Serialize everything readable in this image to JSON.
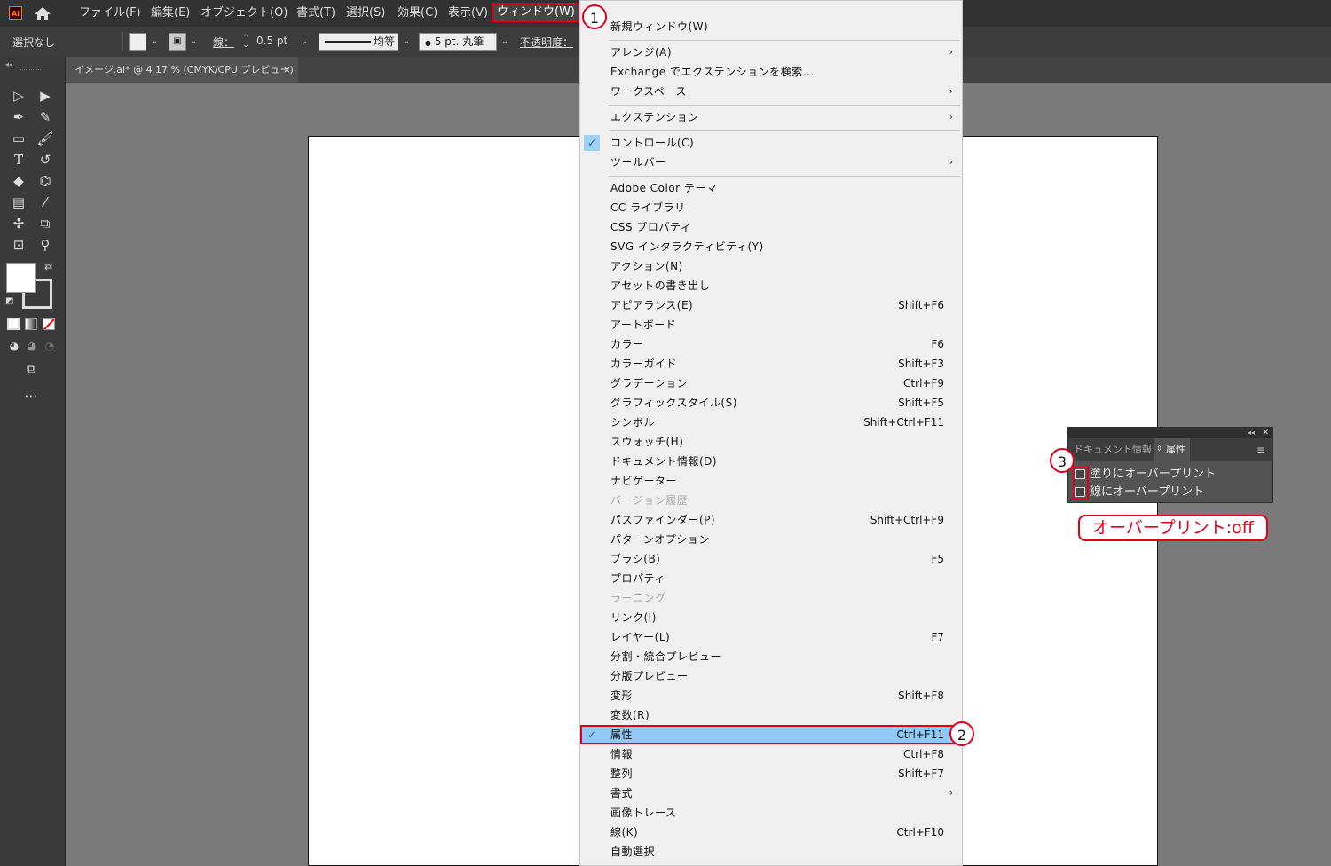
{
  "app": {
    "logo": "Ai"
  },
  "menubar": {
    "items": [
      "ファイル(F)",
      "編集(E)",
      "オブジェクト(O)",
      "書式(T)",
      "選択(S)",
      "効果(C)",
      "表示(V)"
    ],
    "active": "ウィンドウ(W)"
  },
  "control_bar": {
    "selection": "選択なし",
    "stroke_label": "線：",
    "stroke_weight": "0.5 pt",
    "stroke_profile": "均等",
    "brush": "5 pt. 丸筆",
    "opacity_label": "不透明度："
  },
  "document_tab": {
    "title": "イメージ.ai* @ 4.17 % (CMYK/CPU プレビュー)",
    "close": "×"
  },
  "dropdown": {
    "items": [
      {
        "label": "新規ウィンドウ(W)"
      },
      {
        "label": "アレンジ(A)",
        "submenu": true
      },
      {
        "label": "Exchange でエクステンションを検索..."
      },
      {
        "label": "ワークスペース",
        "submenu": true
      },
      {
        "label": "エクステンション",
        "submenu": true
      },
      {
        "label": "コントロール(C)",
        "checked": true
      },
      {
        "label": "ツールバー",
        "submenu": true
      },
      {
        "label": "Adobe Color テーマ"
      },
      {
        "label": "CC ライブラリ"
      },
      {
        "label": "CSS プロパティ"
      },
      {
        "label": "SVG インタラクティビティ(Y)"
      },
      {
        "label": "アクション(N)"
      },
      {
        "label": "アセットの書き出し"
      },
      {
        "label": "アピアランス(E)",
        "shortcut": "Shift+F6"
      },
      {
        "label": "アートボード"
      },
      {
        "label": "カラー",
        "shortcut": "F6"
      },
      {
        "label": "カラーガイド",
        "shortcut": "Shift+F3"
      },
      {
        "label": "グラデーション",
        "shortcut": "Ctrl+F9"
      },
      {
        "label": "グラフィックスタイル(S)",
        "shortcut": "Shift+F5"
      },
      {
        "label": "シンボル",
        "shortcut": "Shift+Ctrl+F11"
      },
      {
        "label": "スウォッチ(H)"
      },
      {
        "label": "ドキュメント情報(D)"
      },
      {
        "label": "ナビゲーター"
      },
      {
        "label": "バージョン履歴",
        "disabled": true
      },
      {
        "label": "パスファインダー(P)",
        "shortcut": "Shift+Ctrl+F9"
      },
      {
        "label": "パターンオプション"
      },
      {
        "label": "ブラシ(B)",
        "shortcut": "F5"
      },
      {
        "label": "プロパティ"
      },
      {
        "label": "ラーニング",
        "disabled": true
      },
      {
        "label": "リンク(I)"
      },
      {
        "label": "レイヤー(L)",
        "shortcut": "F7"
      },
      {
        "label": "分割・統合プレビュー"
      },
      {
        "label": "分版プレビュー"
      },
      {
        "label": "変形",
        "shortcut": "Shift+F8"
      },
      {
        "label": "変数(R)"
      },
      {
        "label": "属性",
        "shortcut": "Ctrl+F11",
        "checked": true,
        "highlight": true
      },
      {
        "label": "情報",
        "shortcut": "Ctrl+F8"
      },
      {
        "label": "整列",
        "shortcut": "Shift+F7"
      },
      {
        "label": "書式",
        "submenu": true
      },
      {
        "label": "画像トレース"
      },
      {
        "label": "線(K)",
        "shortcut": "Ctrl+F10"
      },
      {
        "label": "自動選択"
      }
    ]
  },
  "attr_panel": {
    "tab_inactive": "ドキュメント情報",
    "tab_active": "属性",
    "fill_overprint": "塗りにオーバープリント",
    "stroke_overprint": "線にオーバープリント",
    "collapse": "◂◂",
    "close": "✕"
  },
  "annotations": {
    "badge1": "1",
    "badge2": "2",
    "badge3": "3",
    "callout": "オーバープリント:off"
  },
  "colors": {
    "accent_red": "#e0001b",
    "menu_highlight": "#91c8f6"
  }
}
